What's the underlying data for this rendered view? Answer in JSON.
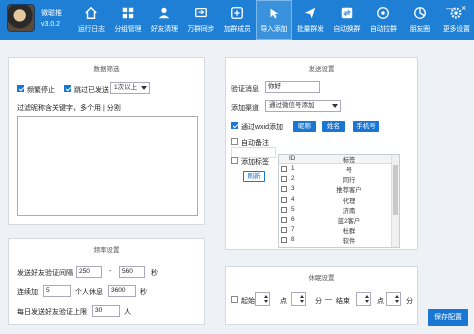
{
  "app": {
    "name": "微聪推",
    "version": "v3.0.2"
  },
  "nav": [
    {
      "label": "运行日志",
      "icon": "home-icon",
      "active": false
    },
    {
      "label": "分组管理",
      "icon": "group-manage-icon",
      "active": false
    },
    {
      "label": "好友清理",
      "icon": "friend-clean-icon",
      "active": false
    },
    {
      "label": "万群同步",
      "icon": "group-sync-icon",
      "active": false
    },
    {
      "label": "加群成员",
      "icon": "add-member-icon",
      "active": false
    },
    {
      "label": "导入添加",
      "icon": "import-add-icon",
      "active": true
    },
    {
      "label": "批量群发",
      "icon": "mass-send-icon",
      "active": false
    },
    {
      "label": "自动换群",
      "icon": "auto-switch-icon",
      "active": false
    },
    {
      "label": "自动拉群",
      "icon": "auto-pull-icon",
      "active": false
    },
    {
      "label": "朋友圈",
      "icon": "moments-icon",
      "active": false
    },
    {
      "label": "更多设置",
      "icon": "settings-icon",
      "active": false
    }
  ],
  "window": {
    "minimize": "—",
    "close": "×"
  },
  "filter": {
    "title": "数据筛选",
    "frequent_stop": "频繁停止",
    "skip_sent": "跳过已发送",
    "skip_select": "1次以上",
    "keywords_label": "过滤昵称含关键字，多个用 | 分割"
  },
  "freq": {
    "title": "频率设置",
    "interval_label": "发送好友验证间隔",
    "interval_min": "250",
    "interval_sep": "-",
    "interval_max": "560",
    "interval_unit": "秒",
    "rest_label1": "连续加",
    "rest_count": "5",
    "rest_label2": "个人休息",
    "rest_secs": "3600",
    "rest_unit": "秒",
    "daily_label": "每日发送好友验证上限",
    "daily_limit": "30",
    "daily_unit": "人"
  },
  "send": {
    "title": "发送设置",
    "verify_label": "验证消息",
    "verify_value": "你好",
    "channel_label": "添加渠道",
    "channel_value": "通过微信号添加",
    "wxid_label": "通过wxid添加",
    "tabs": [
      "昵称",
      "姓名",
      "手机号"
    ],
    "remark_label": "自动备注",
    "tag_label": "添加标签",
    "refresh": "刷新",
    "grid_headers": {
      "id": "ID",
      "tag": "标签"
    },
    "tags": [
      {
        "id": "1",
        "name": "号"
      },
      {
        "id": "2",
        "name": "同行"
      },
      {
        "id": "3",
        "name": "推荐客户"
      },
      {
        "id": "4",
        "name": "代理"
      },
      {
        "id": "5",
        "name": "济南"
      },
      {
        "id": "6",
        "name": "蓝2客户"
      },
      {
        "id": "7",
        "name": "杜群"
      },
      {
        "id": "8",
        "name": "软件"
      }
    ]
  },
  "rest": {
    "title": "休眠设置",
    "start_label": "起始",
    "point": "点",
    "minute": "分",
    "sep": "—",
    "end_label": "结束"
  },
  "save_label": "保存配置"
}
